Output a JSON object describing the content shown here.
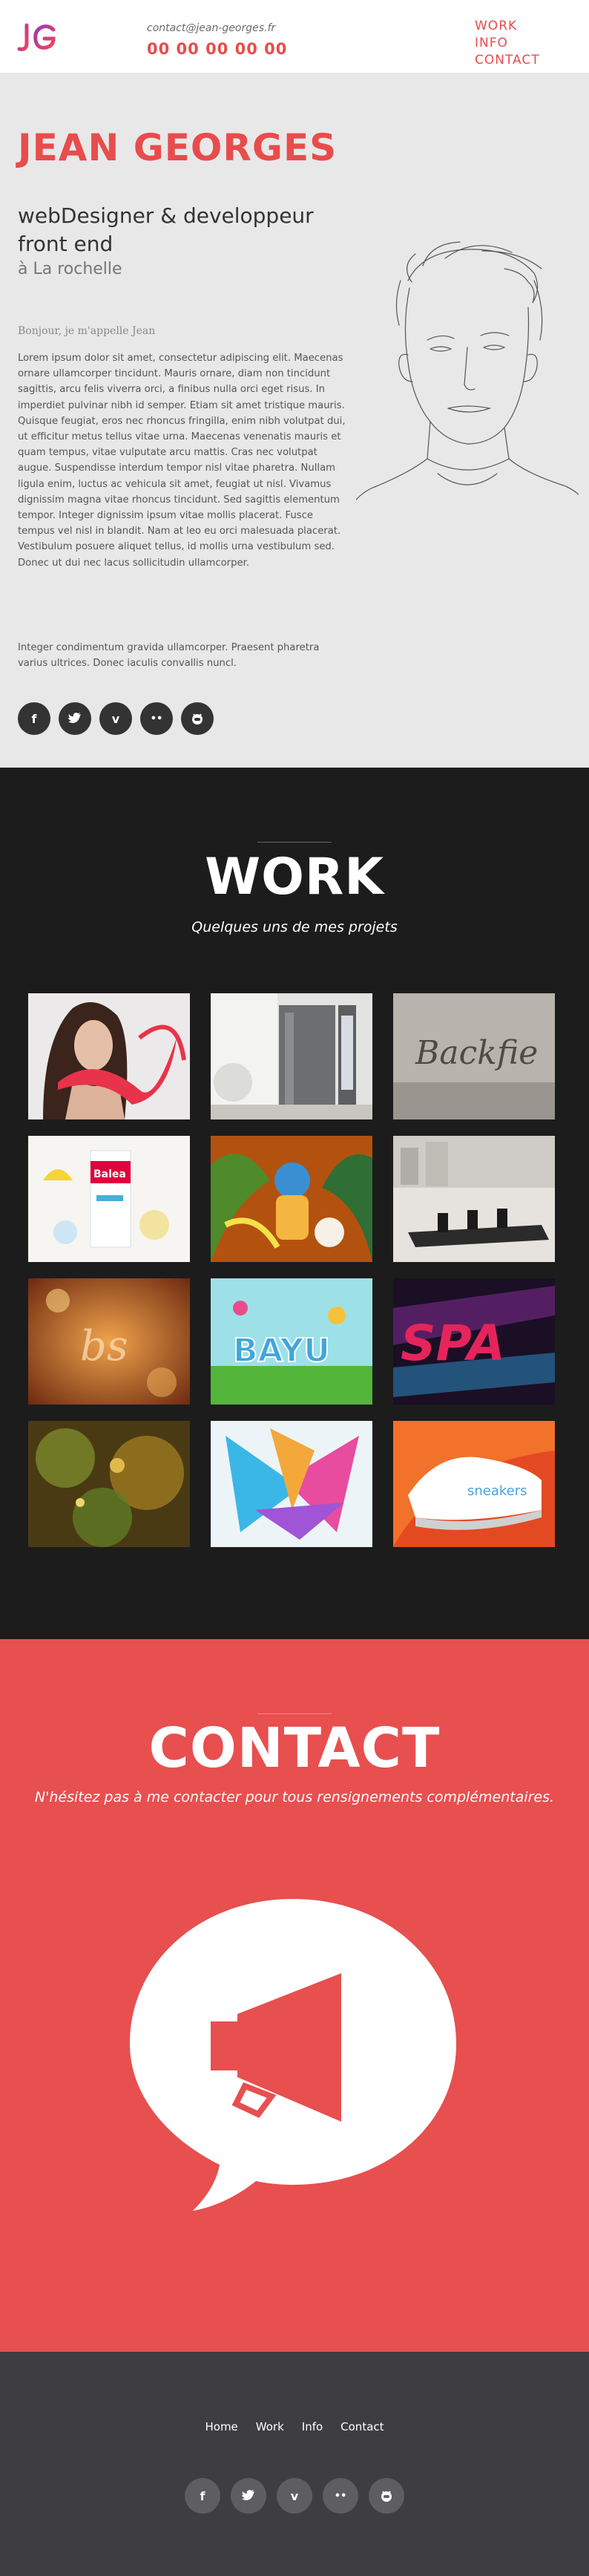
{
  "header": {
    "logo_text": "JG",
    "email": "contact@jean-georges.fr",
    "phone": "00 00 00 00 00",
    "nav": [
      "WORK",
      "INFO",
      "CONTACT"
    ]
  },
  "hero": {
    "name": "JEAN GEORGES",
    "role": "webDesigner & developpeur front end",
    "city": "à La rochelle",
    "greeting": "Bonjour, je m'appelle Jean",
    "paragraph1": "Lorem ipsum dolor sit amet, consectetur adipiscing elit. Maecenas ornare ullamcorper tincidunt. Mauris ornare, diam non tincidunt sagittis, arcu felis viverra orci, a finibus nulla orci eget risus. In imperdiet pulvinar nibh id semper. Etiam sit amet tristique mauris. Quisque feugiat, eros nec rhoncus fringilla, enim nibh volutpat dui, ut efficitur metus tellus vitae urna. Maecenas venenatis mauris et quam tempus, vitae vulputate arcu mattis. Cras nec volutpat augue. Suspendisse interdum tempor nisl vitae pharetra. Nullam ligula enim, luctus ac vehicula sit amet, feugiat ut nisl. Vivamus dignissim magna vitae rhoncus tincidunt. Sed sagittis elementum tempor. Integer dignissim ipsum vitae mollis placerat. Fusce tempus vel nisl in blandit. Nam at leo eu orci malesuada placerat. Vestibulum posuere aliquet tellus, id mollis urna vestibulum sed. Donec ut dui nec lacus sollicitudin ullamcorper.",
    "paragraph2": "Integer condimentum gravida ullamcorper. Praesent pharetra varius ultrices. Donec iaculis convallis nuncl.",
    "socials": [
      {
        "icon": "facebook-icon",
        "glyph": "f"
      },
      {
        "icon": "twitter-icon",
        "glyph": "t"
      },
      {
        "icon": "vimeo-icon",
        "glyph": "v"
      },
      {
        "icon": "flickr-icon",
        "glyph": "••"
      },
      {
        "icon": "github-icon",
        "glyph": "◙"
      }
    ]
  },
  "work": {
    "title": "WORK",
    "subtitle": "Quelques uns de mes projets",
    "tile_texts": {
      "packaging_brand": "Balea",
      "logo_word": "Backfie",
      "bayu_word": "BAYU",
      "spa_word": "SPA",
      "sneaker_word": "sneakers"
    }
  },
  "contact": {
    "title": "CONTACT",
    "subtitle": "N'hésitez pas à me contacter pour tous rensignements complémentaires."
  },
  "footer": {
    "nav": [
      "Home",
      "Work",
      "Info",
      "Contact"
    ]
  },
  "colors": {
    "accent": "#e84c4c",
    "dark": "#1c1c1d",
    "footer": "#3e3e40"
  }
}
